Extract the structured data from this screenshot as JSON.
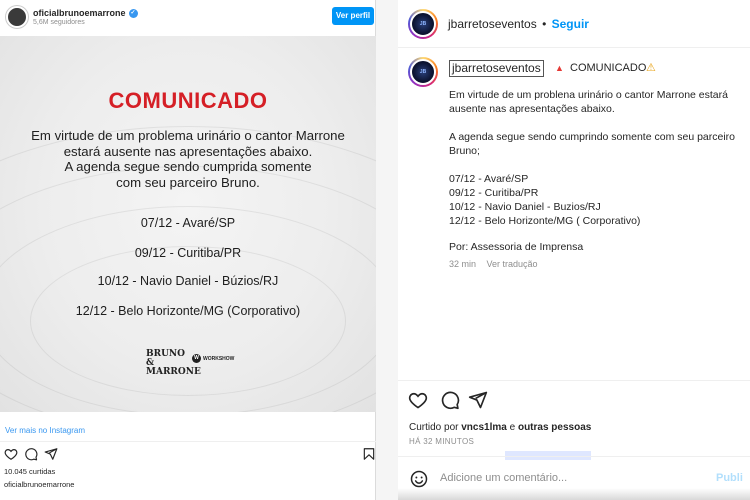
{
  "embed": {
    "username": "oficialbrunoemarrone",
    "followers": "5,6M seguidores",
    "view_profile_button": "Ver perfil",
    "image": {
      "title": "COMUNICADO",
      "body_lines": [
        "Em virtude de um problema urinário o cantor Marrone",
        "estará ausente nas apresentações  abaixo.",
        "A agenda segue sendo cumprida somente",
        "com seu parceiro Bruno."
      ],
      "dates": [
        "07/12 - Avaré/SP",
        "09/12 - Curitiba/PR",
        "10/12 - Navio Daniel - Búzios/RJ",
        "12/12 - Belo Horizonte/MG (Corporativo)"
      ],
      "logo_bruno_marrone": "BRUNO & MARRONE",
      "logo_workshow": "WORKSHOW"
    },
    "view_more": "Ver mais no Instagram",
    "likes": "10.045 curtidas",
    "owner": "oficialbrunoemarrone"
  },
  "post": {
    "username": "jbarretoseventos",
    "separator": "•",
    "follow": "Seguir",
    "caption": {
      "username": "jbarretoseventos",
      "title": "COMUNICADO",
      "lines": [
        "Em virtude de um problena urinário o cantor Marrone estará",
        "ausente nas apresentações abaixo.",
        "",
        "A agenda segue sendo cumprindo somente com seu parceiro",
        "Bruno;",
        "",
        "07/12 - Avaré/SP",
        "09/12 - Curitiba/PR",
        "10/12 - Navio Daniel - Buzios/RJ",
        "12/12 - Belo Horizonte/MG ( Corporativo)",
        "",
        "Por: Assessoria de Imprensa"
      ],
      "time": "32 min",
      "translate": "Ver tradução"
    },
    "liked_prefix": "Curtido por",
    "liked_user": "vncs1lma",
    "liked_and": "e",
    "liked_others": "outras pessoas",
    "time_ago": "HÁ 32 MINUTOS",
    "comment_placeholder": "Adicione um comentário...",
    "publish": "Publi"
  },
  "colors": {
    "accent": "#0095f6",
    "title_red": "#d51f26",
    "muted": "#8e8e8e"
  }
}
